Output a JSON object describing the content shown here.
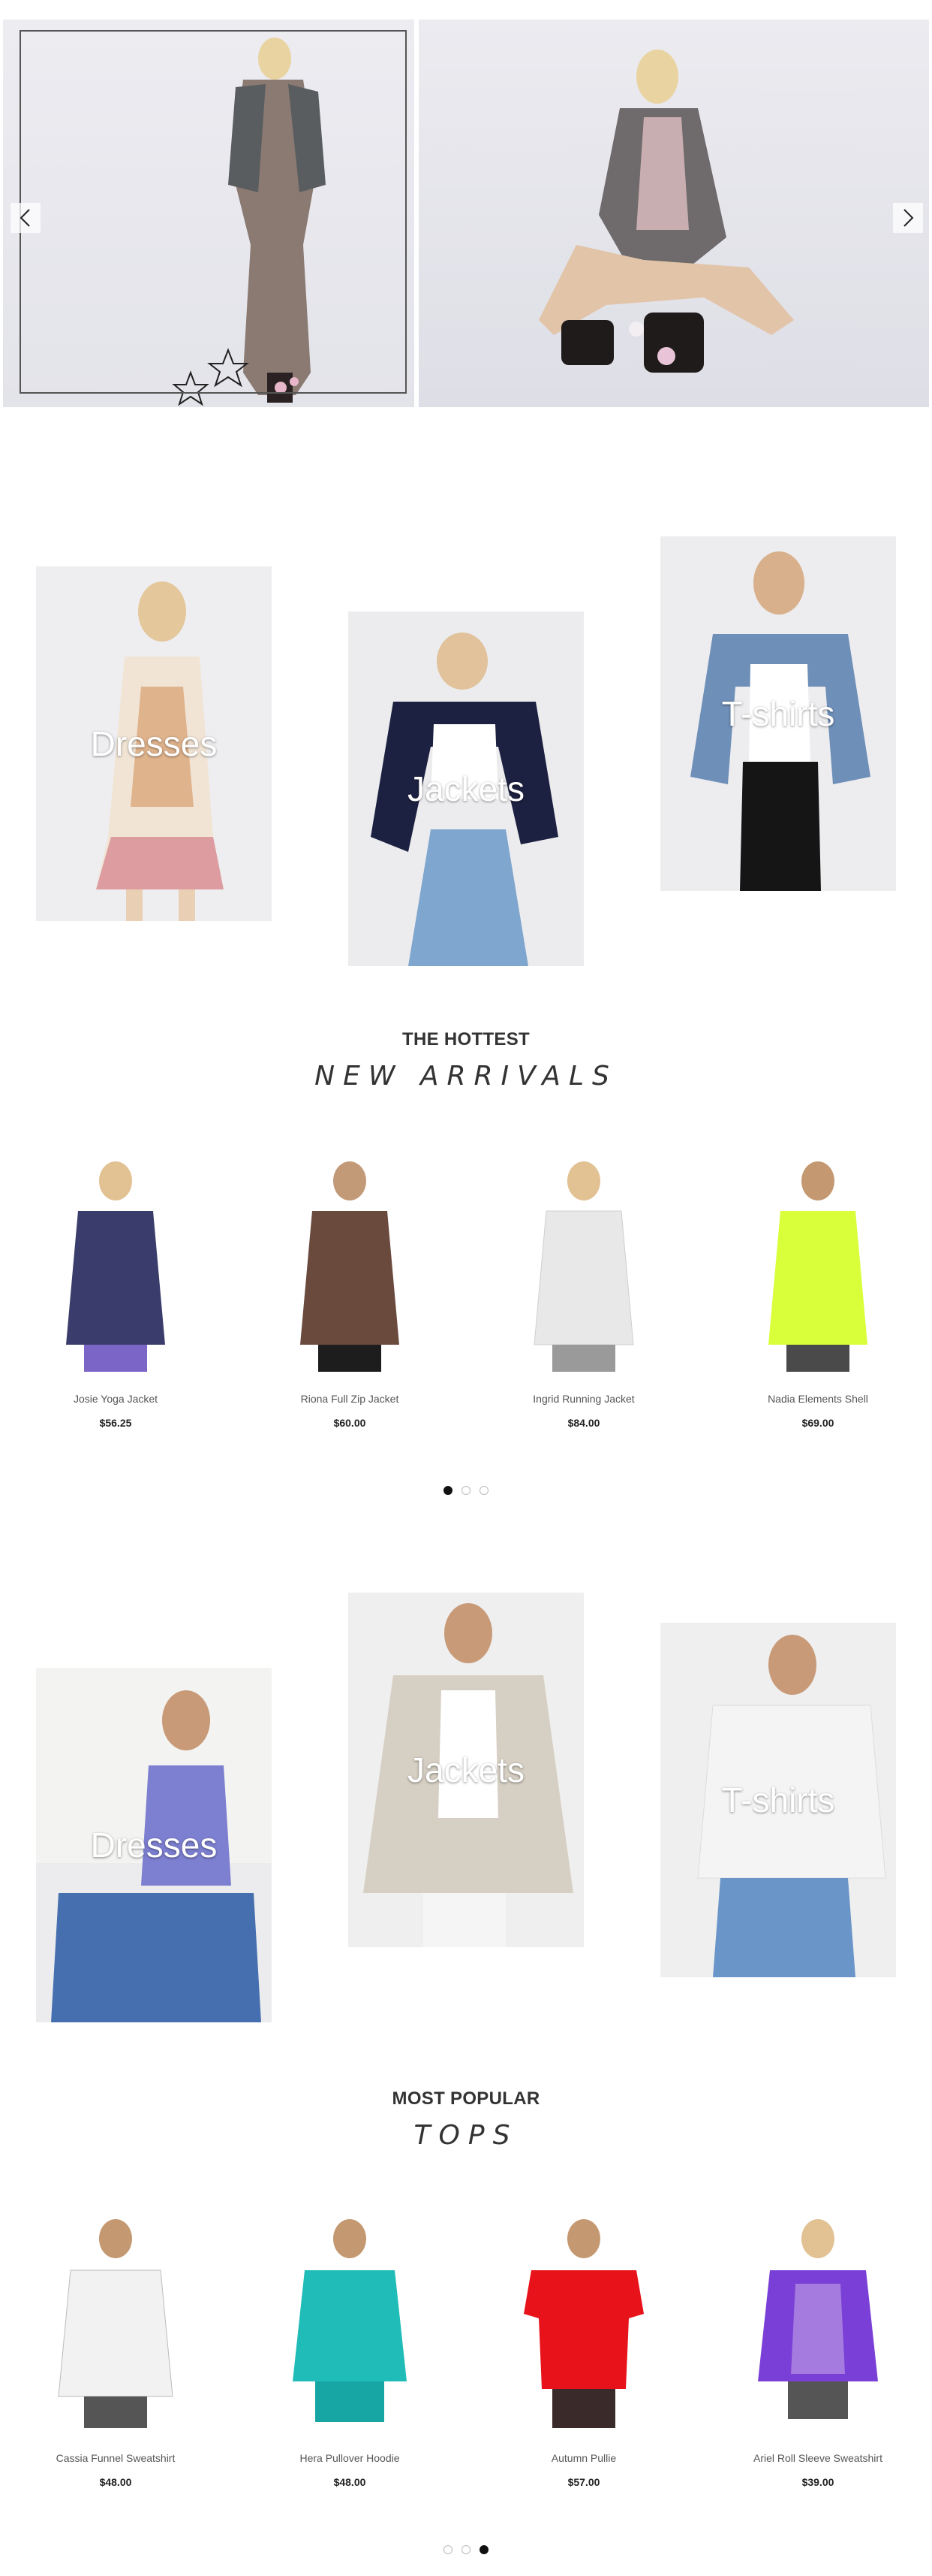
{
  "hero": {
    "prev_icon": "chevron-left-icon",
    "next_icon": "chevron-right-icon"
  },
  "categories_1": [
    {
      "label": "Dresses"
    },
    {
      "label": "Jackets"
    },
    {
      "label": "T-shirts"
    }
  ],
  "new_arrivals": {
    "subtitle": "THE HOTTEST",
    "title": "NEW ARRIVALS",
    "products": [
      {
        "name": "Josie Yoga Jacket",
        "price": "$56.25",
        "color": "#3a3d6b"
      },
      {
        "name": "Riona Full Zip Jacket",
        "price": "$60.00",
        "color": "#6b4a3e"
      },
      {
        "name": "Ingrid Running Jacket",
        "price": "$84.00",
        "color": "#e6e6e6"
      },
      {
        "name": "Nadia Elements Shell",
        "price": "$69.00",
        "color": "#d8ff3a"
      }
    ]
  },
  "categories_2": [
    {
      "label": "Dresses"
    },
    {
      "label": "Jackets"
    },
    {
      "label": "T-shirts"
    }
  ],
  "tops": {
    "subtitle": "MOST POPULAR",
    "title": "TOPS",
    "products": [
      {
        "name": "Cassia Funnel Sweatshirt",
        "price": "$48.00",
        "color": "#f2f2f2"
      },
      {
        "name": "Hera Pullover Hoodie",
        "price": "$48.00",
        "color": "#1fbcb8"
      },
      {
        "name": "Autumn Pullie",
        "price": "$57.00",
        "color": "#e8121a"
      },
      {
        "name": "Ariel Roll Sleeve Sweatshirt",
        "price": "$39.00",
        "color": "#7a3fd6"
      }
    ]
  }
}
